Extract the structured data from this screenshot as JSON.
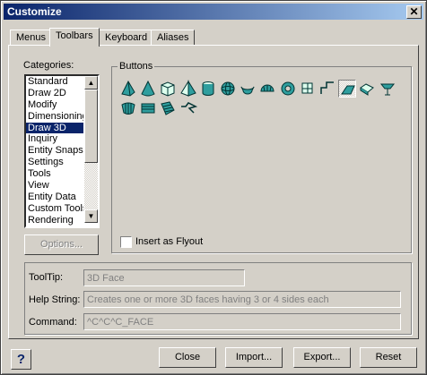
{
  "window": {
    "title": "Customize",
    "close_glyph": "✕"
  },
  "tabs": [
    {
      "label": "Menus",
      "active": false
    },
    {
      "label": "Toolbars",
      "active": true
    },
    {
      "label": "Keyboard",
      "active": false
    },
    {
      "label": "Aliases",
      "active": false
    }
  ],
  "categories": {
    "label": "Categories:",
    "items": [
      "Standard",
      "Draw 2D",
      "Modify",
      "Dimensioning",
      "Draw 3D",
      "Inquiry",
      "Entity Snaps",
      "Settings",
      "Tools",
      "View",
      "Entity Data",
      "Custom Tools",
      "Rendering"
    ],
    "selected": "Draw 3D"
  },
  "options_button": "Options...",
  "buttons_group": {
    "label": "Buttons",
    "icons": [
      "pyramid-icon",
      "cone-icon",
      "box-icon",
      "pyramid-alt-icon",
      "cylinder-icon",
      "sphere-icon",
      "dish-icon",
      "dome-icon",
      "torus-icon",
      "wedge-icon",
      "3d-polyline-icon",
      "3d-face-icon",
      "extrude-icon",
      "revolve-icon",
      "ruled-surface-icon",
      "tabulated-surface-icon",
      "edge-surface-icon",
      "mesh-icon"
    ],
    "pressed": "3d-face-icon"
  },
  "flyout": {
    "label": "Insert as Flyout",
    "checked": false
  },
  "info": {
    "tooltip_label": "ToolTip:",
    "tooltip_value": "3D Face",
    "help_label": "Help String:",
    "help_value": "Creates one or more 3D faces having 3 or 4 sides each",
    "command_label": "Command:",
    "command_value": "^C^C^C_FACE"
  },
  "footer": {
    "help_glyph": "?",
    "close": "Close",
    "import": "Import...",
    "export": "Export...",
    "reset": "Reset"
  },
  "colors": {
    "titlebar": "#0a246a",
    "selection": "#0a246a",
    "icon_fill": "#2f9e9e"
  }
}
